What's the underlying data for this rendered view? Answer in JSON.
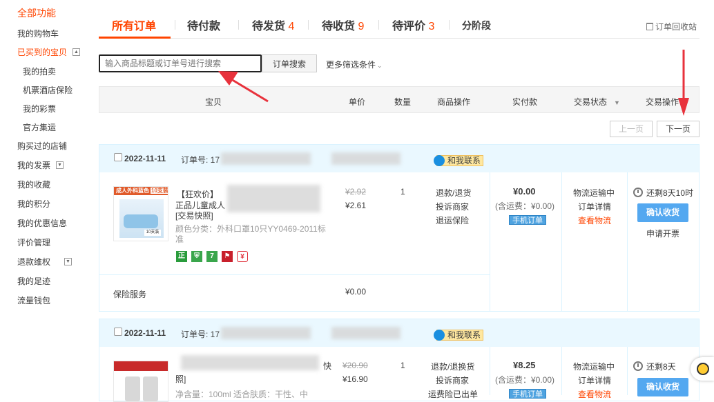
{
  "sidebar": {
    "title": "全部功能",
    "items": [
      {
        "label": "我的购物车"
      },
      {
        "label": "已买到的宝贝"
      },
      {
        "label": "我的拍卖"
      },
      {
        "label": "机票酒店保险"
      },
      {
        "label": "我的彩票"
      },
      {
        "label": "官方集运"
      },
      {
        "label": "购买过的店铺"
      },
      {
        "label": "我的发票"
      },
      {
        "label": "我的收藏"
      },
      {
        "label": "我的积分"
      },
      {
        "label": "我的优惠信息"
      },
      {
        "label": "评价管理"
      },
      {
        "label": "退款维权"
      },
      {
        "label": "我的足迹"
      },
      {
        "label": "流量钱包"
      }
    ]
  },
  "tabs": {
    "all": "所有订单",
    "pending_payment": "待付款",
    "pending_ship": "待发货",
    "pending_ship_count": "4",
    "pending_receive": "待收货",
    "pending_receive_count": "9",
    "pending_review": "待评价",
    "pending_review_count": "3",
    "installment": "分阶段",
    "recycle_bin": "订单回收站"
  },
  "search": {
    "placeholder": "输入商品标题或订单号进行搜索",
    "button": "订单搜索",
    "more_filters": "更多筛选条件"
  },
  "table_header": {
    "item": "宝贝",
    "unit_price": "单价",
    "quantity": "数量",
    "item_ops": "商品操作",
    "paid": "实付款",
    "status": "交易状态",
    "actions": "交易操作"
  },
  "pager": {
    "prev": "上一页",
    "next": "下一页"
  },
  "orders": [
    {
      "date": "2022-11-11",
      "order_no_label": "订单号: 17",
      "contact": "和我联系",
      "item_title_1": "【狂欢价】",
      "item_title_2": "正品儿童成人",
      "item_title_3": "[交易快照]",
      "item_attr": "颜色分类：外科口罩10只YY0469-2011标准",
      "thumb_label": "成人外科蓝色",
      "thumb_count": "10支装",
      "thumb_pack": "10支装",
      "original_price": "¥2.92",
      "price": "¥2.61",
      "quantity": "1",
      "ops": [
        "退款/退货",
        "投诉商家",
        "退运保险"
      ],
      "paid": "¥0.00",
      "shipping": "(含运费：¥0.00)",
      "mobile_badge": "手机订单",
      "status_1": "物流运输中",
      "status_2": "订单详情",
      "status_3": "查看物流",
      "countdown": "还剩8天10时",
      "confirm": "确认收货",
      "invoice": "申请开票",
      "insurance_label": "保险服务",
      "insurance_price": "¥0.00"
    },
    {
      "date": "2022-11-11",
      "order_no_label": "订单号: 17",
      "contact": "和我联系",
      "item_title_1": "快",
      "item_title_2": "照]",
      "item_attr": "净含量：100ml 适合肤质：干性、中",
      "original_price": "¥20.90",
      "price": "¥16.90",
      "quantity": "1",
      "ops": [
        "退款/退换货",
        "投诉商家",
        "运费险已出单"
      ],
      "paid": "¥8.25",
      "shipping": "(含运费：¥0.00)",
      "mobile_badge": "手机订单",
      "status_1": "物流运输中",
      "status_2": "订单详情",
      "status_3": "查看物流",
      "countdown": "还剩8天",
      "confirm": "确认收货"
    }
  ],
  "colors": {
    "accent": "#ff4400",
    "confirm_blue": "#54a8f0",
    "order_header": "#eaf8ff",
    "arrow_red": "#e8323c"
  }
}
